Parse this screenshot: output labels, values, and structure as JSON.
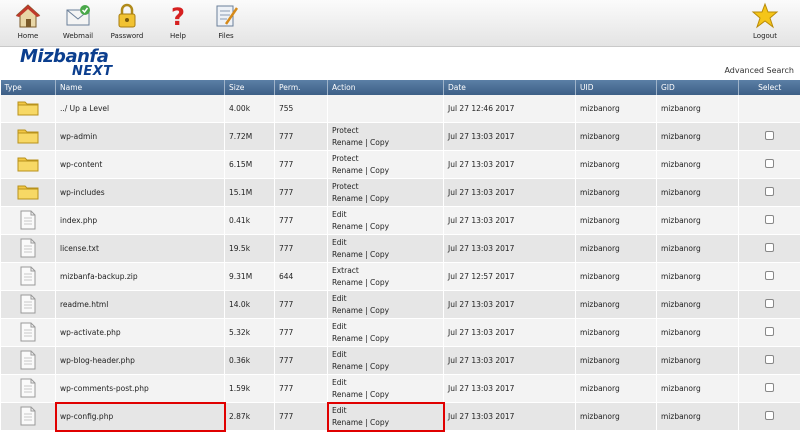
{
  "toolbar": {
    "home": "Home",
    "webmail": "Webmail",
    "password": "Password",
    "help": "Help",
    "files": "Files",
    "logout": "Logout"
  },
  "brand": {
    "top": "Mizbanfa",
    "bottom": "NEXT"
  },
  "advanced_search": "Advanced Search",
  "columns": [
    "Type",
    "Name",
    "Size",
    "Perm.",
    "Action",
    "Date",
    "UID",
    "GID",
    "Select"
  ],
  "rows": [
    {
      "type": "folder",
      "name": "../ Up a Level",
      "size": "4.00k",
      "perm": "755",
      "action1": "",
      "action2": "",
      "date": "Jul 27 12:46 2017",
      "uid": "mizbanorg",
      "gid": "mizbanorg",
      "select": false
    },
    {
      "type": "folder",
      "name": "wp-admin",
      "size": "7.72M",
      "perm": "777",
      "action1": "Protect",
      "action2": "Rename | Copy",
      "date": "Jul 27 13:03 2017",
      "uid": "mizbanorg",
      "gid": "mizbanorg",
      "select": true
    },
    {
      "type": "folder",
      "name": "wp-content",
      "size": "6.15M",
      "perm": "777",
      "action1": "Protect",
      "action2": "Rename | Copy",
      "date": "Jul 27 13:03 2017",
      "uid": "mizbanorg",
      "gid": "mizbanorg",
      "select": true
    },
    {
      "type": "folder",
      "name": "wp-includes",
      "size": "15.1M",
      "perm": "777",
      "action1": "Protect",
      "action2": "Rename | Copy",
      "date": "Jul 27 13:03 2017",
      "uid": "mizbanorg",
      "gid": "mizbanorg",
      "select": true
    },
    {
      "type": "file",
      "name": "index.php",
      "size": "0.41k",
      "perm": "777",
      "action1": "Edit",
      "action2": "Rename | Copy",
      "date": "Jul 27 13:03 2017",
      "uid": "mizbanorg",
      "gid": "mizbanorg",
      "select": true
    },
    {
      "type": "file",
      "name": "license.txt",
      "size": "19.5k",
      "perm": "777",
      "action1": "Edit",
      "action2": "Rename | Copy",
      "date": "Jul 27 13:03 2017",
      "uid": "mizbanorg",
      "gid": "mizbanorg",
      "select": true
    },
    {
      "type": "file",
      "name": "mizbanfa-backup.zip",
      "size": "9.31M",
      "perm": "644",
      "action1": "Extract",
      "action2": "Rename | Copy",
      "date": "Jul 27 12:57 2017",
      "uid": "mizbanorg",
      "gid": "mizbanorg",
      "select": true
    },
    {
      "type": "file",
      "name": "readme.html",
      "size": "14.0k",
      "perm": "777",
      "action1": "Edit",
      "action2": "Rename | Copy",
      "date": "Jul 27 13:03 2017",
      "uid": "mizbanorg",
      "gid": "mizbanorg",
      "select": true
    },
    {
      "type": "file",
      "name": "wp-activate.php",
      "size": "5.32k",
      "perm": "777",
      "action1": "Edit",
      "action2": "Rename | Copy",
      "date": "Jul 27 13:03 2017",
      "uid": "mizbanorg",
      "gid": "mizbanorg",
      "select": true
    },
    {
      "type": "file",
      "name": "wp-blog-header.php",
      "size": "0.36k",
      "perm": "777",
      "action1": "Edit",
      "action2": "Rename | Copy",
      "date": "Jul 27 13:03 2017",
      "uid": "mizbanorg",
      "gid": "mizbanorg",
      "select": true
    },
    {
      "type": "file",
      "name": "wp-comments-post.php",
      "size": "1.59k",
      "perm": "777",
      "action1": "Edit",
      "action2": "Rename | Copy",
      "date": "Jul 27 13:03 2017",
      "uid": "mizbanorg",
      "gid": "mizbanorg",
      "select": true
    },
    {
      "type": "file",
      "name": "wp-config.php",
      "size": "2.87k",
      "perm": "777",
      "action1": "Edit",
      "action2": "Rename | Copy",
      "date": "Jul 27 13:03 2017",
      "uid": "mizbanorg",
      "gid": "mizbanorg",
      "select": true,
      "highlight": true
    }
  ],
  "colors": {
    "header_blue": "#3d5f86",
    "logo_blue": "#0b3e8e",
    "highlight_red": "#e00000",
    "folder_yellow": "#f2c744"
  },
  "icons": [
    "home-icon",
    "webmail-icon",
    "password-icon",
    "help-icon",
    "files-icon",
    "logout-icon",
    "folder-icon",
    "file-icon"
  ]
}
